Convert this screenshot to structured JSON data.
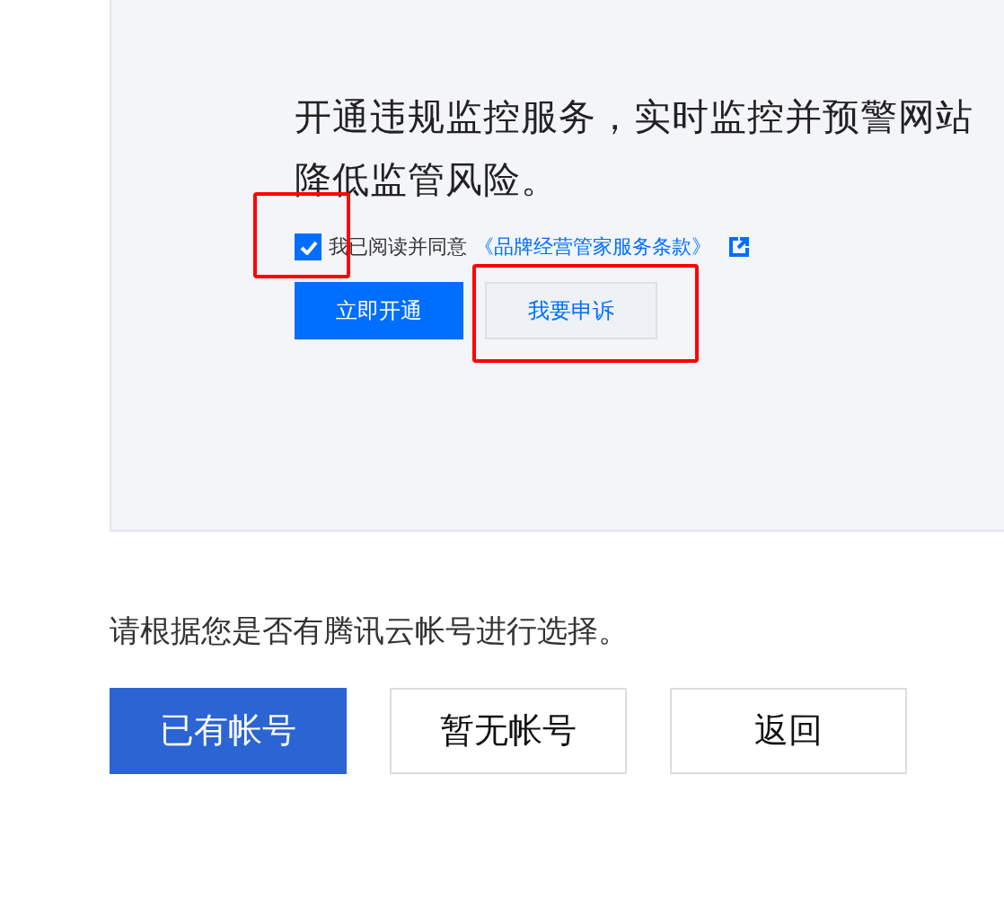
{
  "service_panel": {
    "description_lines": [
      "开通违规监控服务，实时监控并预警网站",
      "降低监管风险。"
    ],
    "agreement": {
      "checked": true,
      "highlighted": true,
      "label": "我已阅读并同意",
      "link": "《品牌经营管家服务条款》"
    },
    "buttons": [
      {
        "label": "立即开通",
        "kind": "primary",
        "highlighted": false
      },
      {
        "label": "我要申诉",
        "kind": "secondary",
        "highlighted": true
      }
    ]
  },
  "prompt": "请根据您是否有腾讯云帐号进行选择。",
  "account_buttons": [
    {
      "label": "已有帐号",
      "selected": true
    },
    {
      "label": "暂无帐号",
      "selected": false
    },
    {
      "label": "返回",
      "selected": false
    }
  ]
}
